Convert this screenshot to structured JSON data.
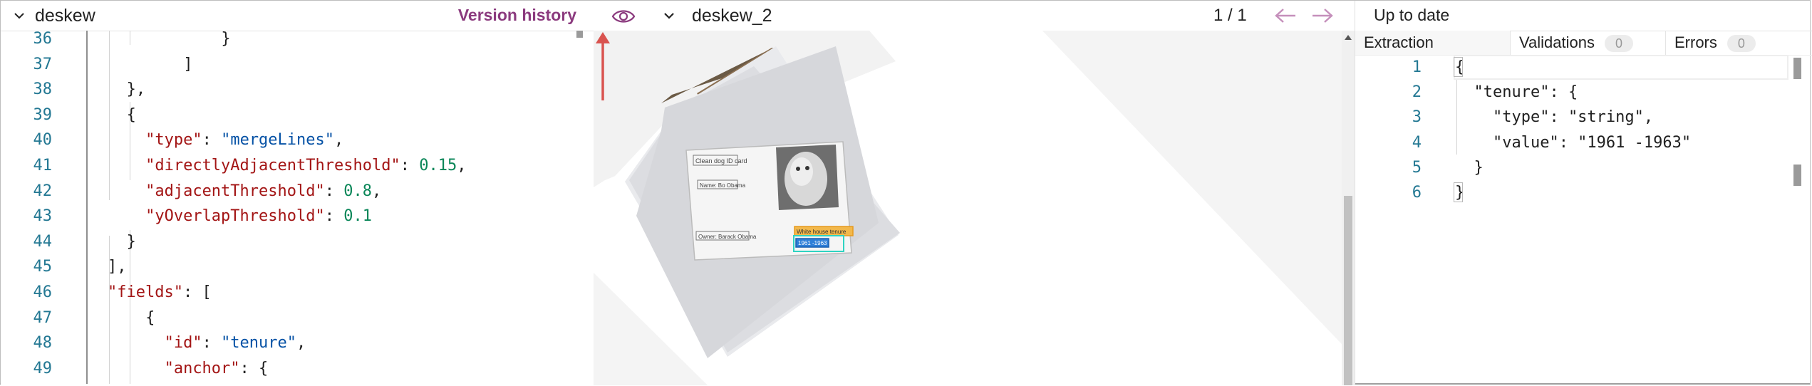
{
  "config_pane": {
    "title": "deskew",
    "version_history_label": "Version history",
    "lines": [
      {
        "num": "36",
        "tokens": [
          {
            "t": "    }",
            "c": "p"
          }
        ]
      },
      {
        "num": "37",
        "tokens": [
          {
            "t": "  ]",
            "c": "p"
          }
        ]
      },
      {
        "num": "38",
        "tokens": [
          {
            "t": "},",
            "c": "p"
          }
        ]
      },
      {
        "num": "39",
        "tokens": [
          {
            "t": "{",
            "c": "p"
          }
        ]
      },
      {
        "num": "40",
        "tokens": [
          {
            "t": "  ",
            "c": "p"
          },
          {
            "t": "\"type\"",
            "c": "k"
          },
          {
            "t": ": ",
            "c": "p"
          },
          {
            "t": "\"mergeLines\"",
            "c": "s"
          },
          {
            "t": ",",
            "c": "p"
          }
        ]
      },
      {
        "num": "41",
        "tokens": [
          {
            "t": "  ",
            "c": "p"
          },
          {
            "t": "\"directlyAdjacentThreshold\"",
            "c": "k"
          },
          {
            "t": ": ",
            "c": "p"
          },
          {
            "t": "0.15",
            "c": "n"
          },
          {
            "t": ",",
            "c": "p"
          }
        ]
      },
      {
        "num": "42",
        "tokens": [
          {
            "t": "  ",
            "c": "p"
          },
          {
            "t": "\"adjacentThreshold\"",
            "c": "k"
          },
          {
            "t": ": ",
            "c": "p"
          },
          {
            "t": "0.8",
            "c": "n"
          },
          {
            "t": ",",
            "c": "p"
          }
        ]
      },
      {
        "num": "43",
        "tokens": [
          {
            "t": "  ",
            "c": "p"
          },
          {
            "t": "\"yOverlapThreshold\"",
            "c": "k"
          },
          {
            "t": ": ",
            "c": "p"
          },
          {
            "t": "0.1",
            "c": "n"
          }
        ]
      },
      {
        "num": "44",
        "tokens": [
          {
            "t": "}",
            "c": "p"
          }
        ]
      },
      {
        "num": "45",
        "tokens": [
          {
            "t": "],",
            "c": "p"
          }
        ]
      },
      {
        "num": "46",
        "tokens": [
          {
            "t": "\"fields\"",
            "c": "k"
          },
          {
            "t": ": [",
            "c": "p"
          }
        ]
      },
      {
        "num": "47",
        "tokens": [
          {
            "t": "  {",
            "c": "p"
          }
        ]
      },
      {
        "num": "48",
        "tokens": [
          {
            "t": "    ",
            "c": "p"
          },
          {
            "t": "\"id\"",
            "c": "k"
          },
          {
            "t": ": ",
            "c": "p"
          },
          {
            "t": "\"tenure\"",
            "c": "s"
          },
          {
            "t": ",",
            "c": "p"
          }
        ]
      },
      {
        "num": "49",
        "tokens": [
          {
            "t": "    ",
            "c": "p"
          },
          {
            "t": "\"anchor\"",
            "c": "k"
          },
          {
            "t": ": {",
            "c": "p"
          }
        ]
      }
    ]
  },
  "viewer_pane": {
    "doc_name": "deskew_2",
    "page_counter": "1 / 1",
    "icons": {
      "toggle": "eye-icon",
      "prev": "arrow-left-icon",
      "next": "arrow-right-icon"
    },
    "document_lines": [
      "Clean dog ID card",
      "Name: Bo Obama",
      "Owner: Barack Obama",
      "White house tenure",
      "1961 -1963"
    ],
    "accent_color": "#8b3a7e"
  },
  "results_pane": {
    "status": "Up to date",
    "tabs": [
      {
        "label": "Extraction"
      },
      {
        "label": "Validations",
        "count": "0"
      },
      {
        "label": "Errors",
        "count": "0"
      }
    ],
    "lines": [
      {
        "num": "1",
        "text": "{"
      },
      {
        "num": "2",
        "text": "  \"tenure\": {"
      },
      {
        "num": "3",
        "text": "    \"type\": \"string\","
      },
      {
        "num": "4",
        "text": "    \"value\": \"1961 -1963\""
      },
      {
        "num": "5",
        "text": "  }"
      },
      {
        "num": "6",
        "text": "}"
      }
    ]
  }
}
